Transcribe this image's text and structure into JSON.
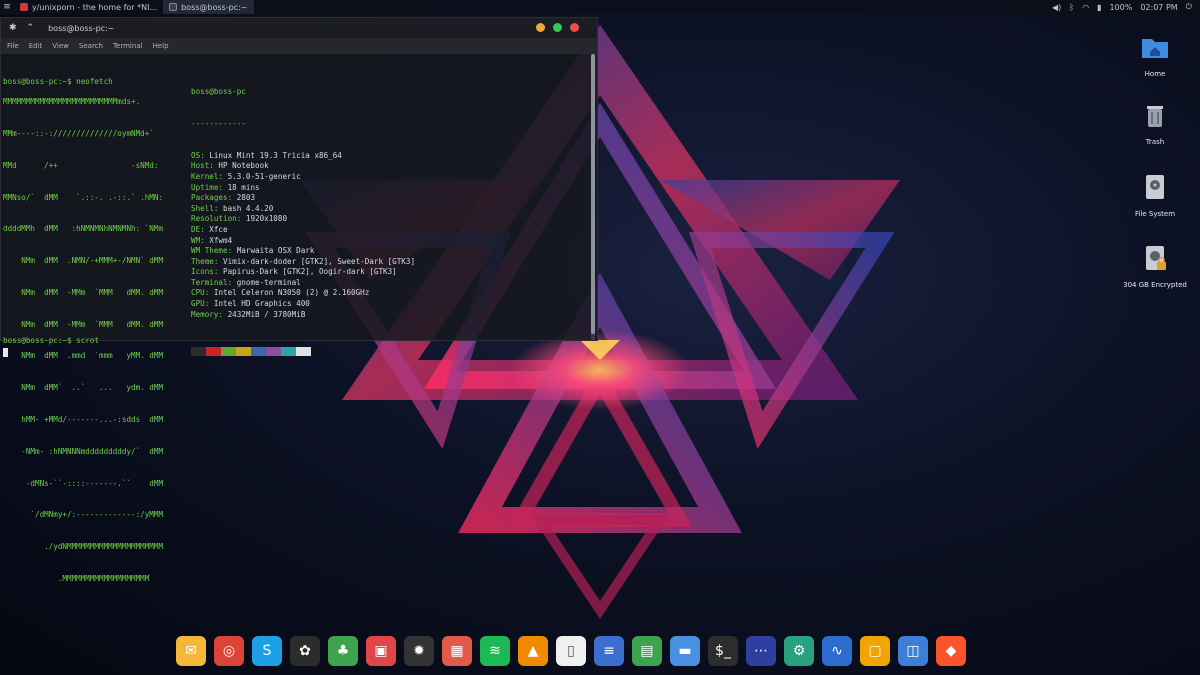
{
  "top_panel": {
    "menu_glyph": "≡",
    "tasks": [
      {
        "label": "y/unixporn - the home for *NI...",
        "icon": "browser-icon",
        "active": false
      },
      {
        "label": "boss@boss-pc:~",
        "icon": "terminal-icon",
        "active": true
      }
    ],
    "battery": "100%",
    "time": "02:07 PM",
    "tray_icons": [
      "volume-icon",
      "bluetooth-icon",
      "wifi-icon",
      "battery-icon",
      "power-icon"
    ]
  },
  "terminal": {
    "title": "boss@boss-pc:~",
    "menu": [
      "File",
      "Edit",
      "View",
      "Search",
      "Terminal",
      "Help"
    ],
    "prompt1": "boss@boss-pc:~$ neofetch",
    "logo": [
      "MMMMMMMMMMMMMMMMMMMMMMMMMmds+.",
      "MMm----::-://////////////oymNMd+`",
      "MMd      /++                -sNMd:",
      "MMNso/`  dMM    `.::-. .-::.` .hMN:",
      "ddddMMh  dMM   :hNMNMNhNMNMNh: `NMm",
      "    NMm  dMM  .NMN/-+MMM+-/NMN` dMM",
      "    NMm  dMM  -MMm  `MMM   dMM. dMM",
      "    NMm  dMM  -MMm  `MMM   dMM. dMM",
      "    NMm  dMM  .mmd  `mmm   yMM. dMM",
      "    NMm  dMM`  ..`   ...   ydm. dMM",
      "    hMM- +MMd/-------...-:sdds  dMM",
      "    -NMm- :hNMNNNmdddddddddy/`  dMM",
      "     -dMNs-``-::::-------.``    dMM",
      "      `/dMNmy+/:-------------:/yMMM",
      "         ./ydNMMMMMMMMMMMMMMMMMMMMM",
      "            .MMMMMMMMMMMMMMMMMMM"
    ],
    "info_title": "boss@boss-pc",
    "info_sep": "------------",
    "info": [
      {
        "k": "OS:",
        "v": " Linux Mint 19.3 Tricia x86_64"
      },
      {
        "k": "Host:",
        "v": " HP Notebook"
      },
      {
        "k": "Kernel:",
        "v": " 5.3.0-51-generic"
      },
      {
        "k": "Uptime:",
        "v": " 18 mins"
      },
      {
        "k": "Packages:",
        "v": " 2803"
      },
      {
        "k": "Shell:",
        "v": " bash 4.4.20"
      },
      {
        "k": "Resolution:",
        "v": " 1920x1080"
      },
      {
        "k": "DE:",
        "v": " Xfce"
      },
      {
        "k": "WM:",
        "v": " Xfwm4"
      },
      {
        "k": "WM Theme:",
        "v": " Marwaita OSX Dark"
      },
      {
        "k": "Theme:",
        "v": " Vimix-dark-doder [GTK2], Sweet-Dark [GTK3]"
      },
      {
        "k": "Icons:",
        "v": " Papirus-Dark [GTK2], Oogir-dark [GTK3]"
      },
      {
        "k": "Terminal:",
        "v": " gnome-terminal"
      },
      {
        "k": "CPU:",
        "v": " Intel Celeron N3050 (2) @ 2.160GHz"
      },
      {
        "k": "GPU:",
        "v": " Intel HD Graphics 400"
      },
      {
        "k": "Memory:",
        "v": " 2432MiB / 3780MiB"
      }
    ],
    "swatches": [
      "#2b2b2b",
      "#d0202a",
      "#5fa92b",
      "#c7a51a",
      "#3d66b2",
      "#8a4fa0",
      "#2aa6a0",
      "#e0e0e0"
    ],
    "prompt2": "boss@boss-pc:~$ scrot"
  },
  "desktop_icons": [
    {
      "label": "Home",
      "icon": "home-folder-icon"
    },
    {
      "label": "Trash",
      "icon": "trash-icon"
    },
    {
      "label": "File System",
      "icon": "drive-icon"
    },
    {
      "label": "304 GB Encrypted",
      "icon": "encrypted-drive-icon"
    }
  ],
  "dock": [
    {
      "name": "mail",
      "icon": "mail-icon",
      "color": "#f4b73a"
    },
    {
      "name": "chrome",
      "icon": "chrome-icon",
      "color": "#db4437"
    },
    {
      "name": "skype",
      "icon": "skype-icon",
      "color": "#1ea0e6"
    },
    {
      "name": "davinci",
      "icon": "davinci-resolve-icon",
      "color": "#2c2c2c"
    },
    {
      "name": "app-green",
      "icon": "green-app-icon",
      "color": "#3ea34d"
    },
    {
      "name": "screenshot",
      "icon": "screenshot-icon",
      "color": "#e04646"
    },
    {
      "name": "aperture",
      "icon": "aperture-icon",
      "color": "#333333"
    },
    {
      "name": "calendar",
      "icon": "calendar-icon",
      "color": "#e25b4a"
    },
    {
      "name": "spotify",
      "icon": "spotify-icon",
      "color": "#1db954"
    },
    {
      "name": "vlc",
      "icon": "vlc-icon",
      "color": "#f08a00"
    },
    {
      "name": "text-doc",
      "icon": "document-icon",
      "color": "#f0f0f0"
    },
    {
      "name": "writer",
      "icon": "writer-icon",
      "color": "#3b6fcf"
    },
    {
      "name": "calc",
      "icon": "spreadsheet-icon",
      "color": "#3ea34d"
    },
    {
      "name": "files",
      "icon": "folder-icon",
      "color": "#4a90e2"
    },
    {
      "name": "terminal",
      "icon": "terminal-icon",
      "color": "#2d2d2d"
    },
    {
      "name": "connect",
      "icon": "network-icon",
      "color": "#2e3fa0"
    },
    {
      "name": "settings",
      "icon": "gear-icon",
      "color": "#2aa080"
    },
    {
      "name": "monitor",
      "icon": "system-monitor-icon",
      "color": "#2c6ccf"
    },
    {
      "name": "virtualbox",
      "icon": "virtualbox-icon",
      "color": "#f2a500"
    },
    {
      "name": "remote",
      "icon": "remote-desktop-icon",
      "color": "#3e7ed8"
    },
    {
      "name": "brave",
      "icon": "brave-icon",
      "color": "#fb542b"
    }
  ]
}
